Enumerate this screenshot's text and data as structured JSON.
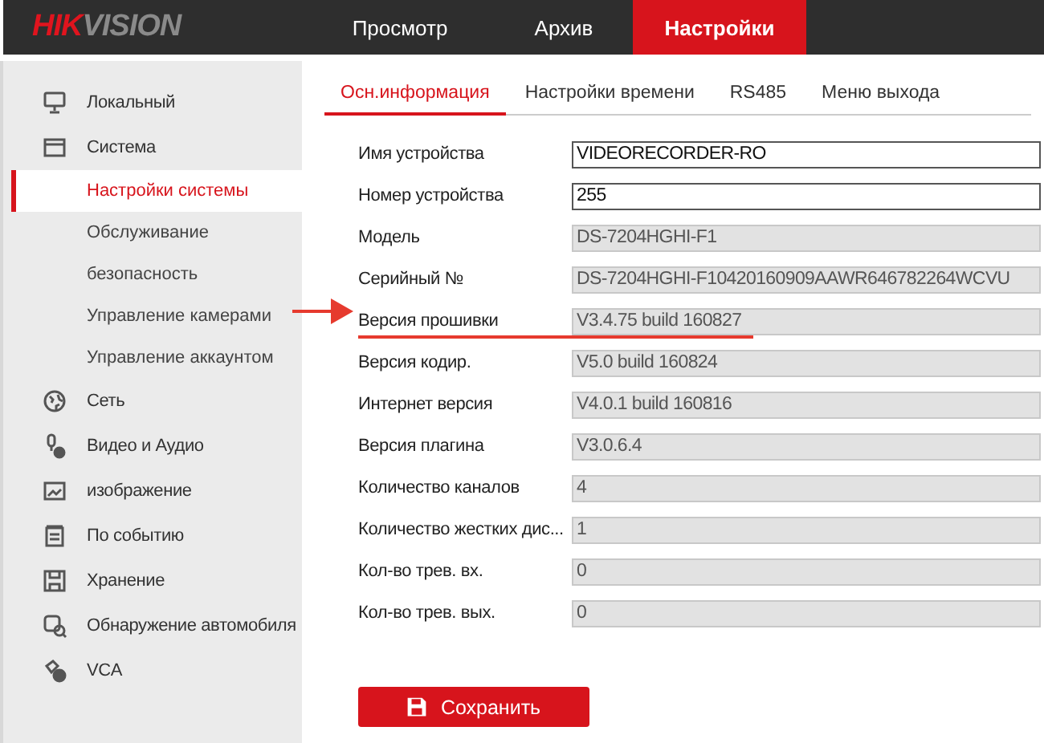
{
  "logo": {
    "accent": "HIK",
    "rest": "VISION"
  },
  "nav": [
    {
      "label": "Просмотр",
      "selected": false
    },
    {
      "label": "Архив",
      "selected": false
    },
    {
      "label": "Настройки",
      "selected": true
    }
  ],
  "sidebar": {
    "items": [
      {
        "label": "Локальный",
        "selected": false
      },
      {
        "label": "Система",
        "selected": false,
        "expanded": true,
        "children": [
          {
            "label": "Настройки системы",
            "selected": true
          },
          {
            "label": "Обслуживание",
            "selected": false
          },
          {
            "label": "безопасность",
            "selected": false
          },
          {
            "label": "Управление камерами",
            "selected": false
          },
          {
            "label": "Управление аккаунтом",
            "selected": false
          }
        ]
      },
      {
        "label": "Сеть",
        "selected": false
      },
      {
        "label": "Видео и Аудио",
        "selected": false
      },
      {
        "label": "изображение",
        "selected": false
      },
      {
        "label": "По событию",
        "selected": false
      },
      {
        "label": "Хранение",
        "selected": false
      },
      {
        "label": "Обнаружение автомобиля",
        "selected": false
      },
      {
        "label": "VCA",
        "selected": false
      }
    ]
  },
  "tabs": [
    {
      "label": "Осн.информация",
      "selected": true
    },
    {
      "label": "Настройки времени",
      "selected": false
    },
    {
      "label": "RS485",
      "selected": false
    },
    {
      "label": "Меню выхода",
      "selected": false
    }
  ],
  "fields": [
    {
      "label": "Имя устройства",
      "value": "VIDEORECORDER-RO",
      "disabled": false
    },
    {
      "label": "Номер устройства",
      "value": "255",
      "disabled": false
    },
    {
      "label": "Модель",
      "value": "DS-7204HGHI-F1",
      "disabled": true
    },
    {
      "label": "Серийный №",
      "value": "DS-7204HGHI-F10420160909AAWR646782264WCVU",
      "disabled": true
    },
    {
      "label": "Версия прошивки",
      "value": "V3.4.75 build 160827",
      "disabled": true,
      "highlighted": true
    },
    {
      "label": "Версия кодир.",
      "value": "V5.0 build 160824",
      "disabled": true
    },
    {
      "label": "Интернет версия",
      "value": "V4.0.1 build 160816",
      "disabled": true
    },
    {
      "label": "Версия плагина",
      "value": "V3.0.6.4",
      "disabled": true
    },
    {
      "label": "Количество каналов",
      "value": "4",
      "disabled": true
    },
    {
      "label": "Количество жестких дис...",
      "value": "1",
      "disabled": true
    },
    {
      "label": "Кол-во трев. вх.",
      "value": "0",
      "disabled": true
    },
    {
      "label": "Кол-во трев. вых.",
      "value": "0",
      "disabled": true
    }
  ],
  "save_button": {
    "label": "Сохранить"
  }
}
